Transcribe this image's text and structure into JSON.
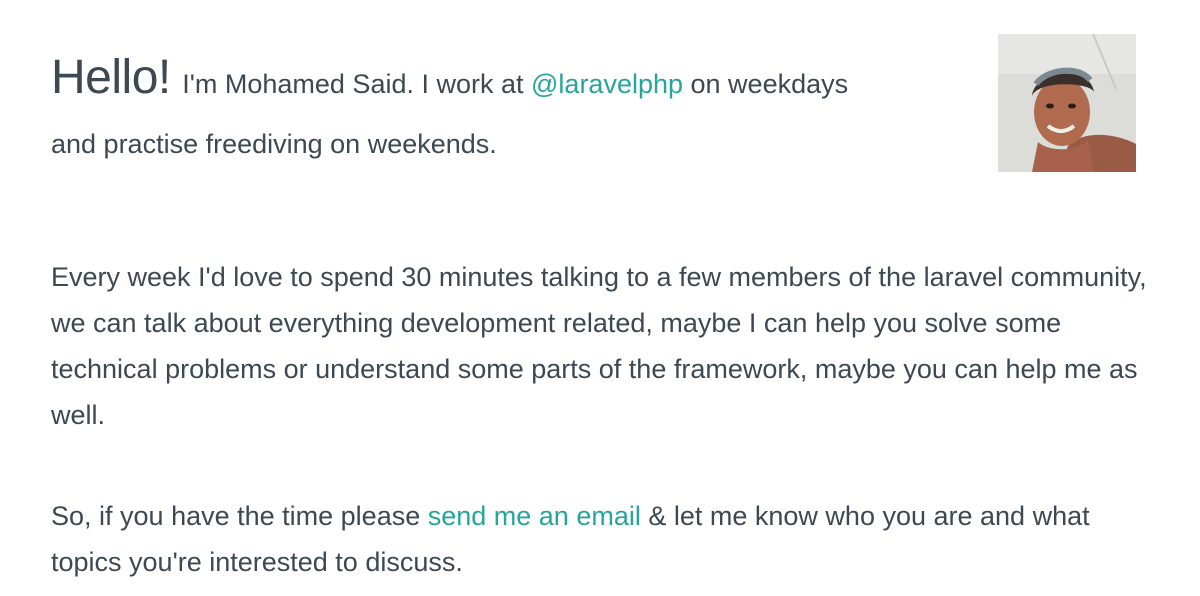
{
  "intro": {
    "greeting": "Hello!",
    "text_before_link": " I'm Mohamed Said. I work at ",
    "handle_link": "@laravelphp",
    "text_after_link_line1": " on weekdays",
    "line2": "and practise freediving on weekends."
  },
  "avatar": {
    "alt": "Mohamed Said profile photo"
  },
  "paragraph1": {
    "text": "Every week I'd love to spend 30 minutes talking to a few members of the laravel community, we can talk about everything development related, maybe I can help you solve some technical problems or understand some parts of the framework, maybe you can help me as well."
  },
  "paragraph2": {
    "text_before_link": "So, if you have the time please ",
    "email_link": "send me an email",
    "text_after_link": " & let me know who you are and what topics you're interested to discuss."
  },
  "colors": {
    "text": "#3d4852",
    "link": "#26a69a",
    "background": "#ffffff"
  }
}
